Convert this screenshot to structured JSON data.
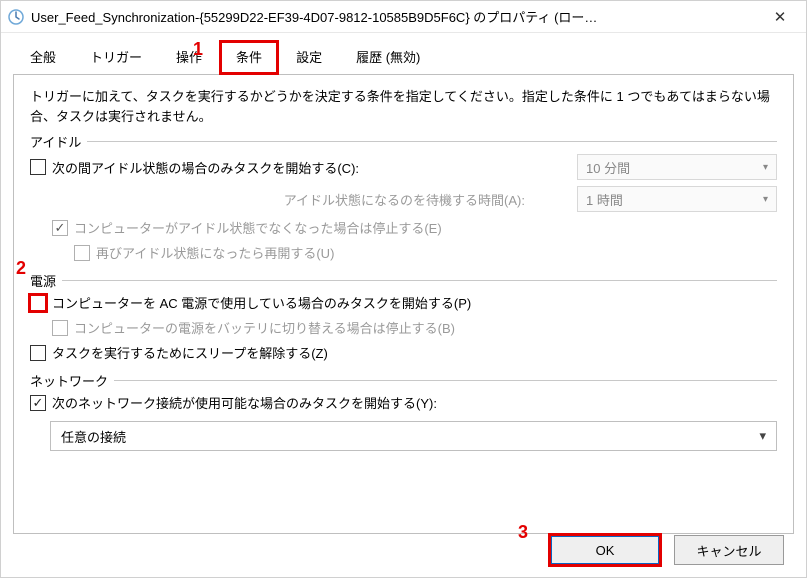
{
  "title": "User_Feed_Synchronization-{55299D22-EF39-4D07-9812-10585B9D5F6C} のプロパティ (ロー…",
  "tabs": {
    "general": "全般",
    "triggers": "トリガー",
    "actions": "操作",
    "conditions": "条件",
    "settings": "設定",
    "history": "履歴 (無効)"
  },
  "description": "トリガーに加えて、タスクを実行するかどうかを決定する条件を指定してください。指定した条件に 1 つでもあてはまらない場合、タスクは実行されません。",
  "groups": {
    "idle": {
      "label": "アイドル",
      "start_only_idle": "次の間アイドル状態の場合のみタスクを開始する(C):",
      "idle_duration": "10 分間",
      "wait_label": "アイドル状態になるのを待機する時間(A):",
      "wait_value": "1 時間",
      "stop_if_not_idle": "コンピューターがアイドル状態でなくなった場合は停止する(E)",
      "restart_on_idle": "再びアイドル状態になったら再開する(U)"
    },
    "power": {
      "label": "電源",
      "start_only_ac": "コンピューターを AC 電源で使用している場合のみタスクを開始する(P)",
      "stop_on_battery": "コンピューターの電源をバッテリに切り替える場合は停止する(B)",
      "wake_to_run": "タスクを実行するためにスリープを解除する(Z)"
    },
    "network": {
      "label": "ネットワーク",
      "start_only_network": "次のネットワーク接続が使用可能な場合のみタスクを開始する(Y):",
      "connection": "任意の接続"
    }
  },
  "buttons": {
    "ok": "OK",
    "cancel": "キャンセル"
  },
  "annotations": {
    "a1": "1",
    "a2": "2",
    "a3": "3"
  }
}
